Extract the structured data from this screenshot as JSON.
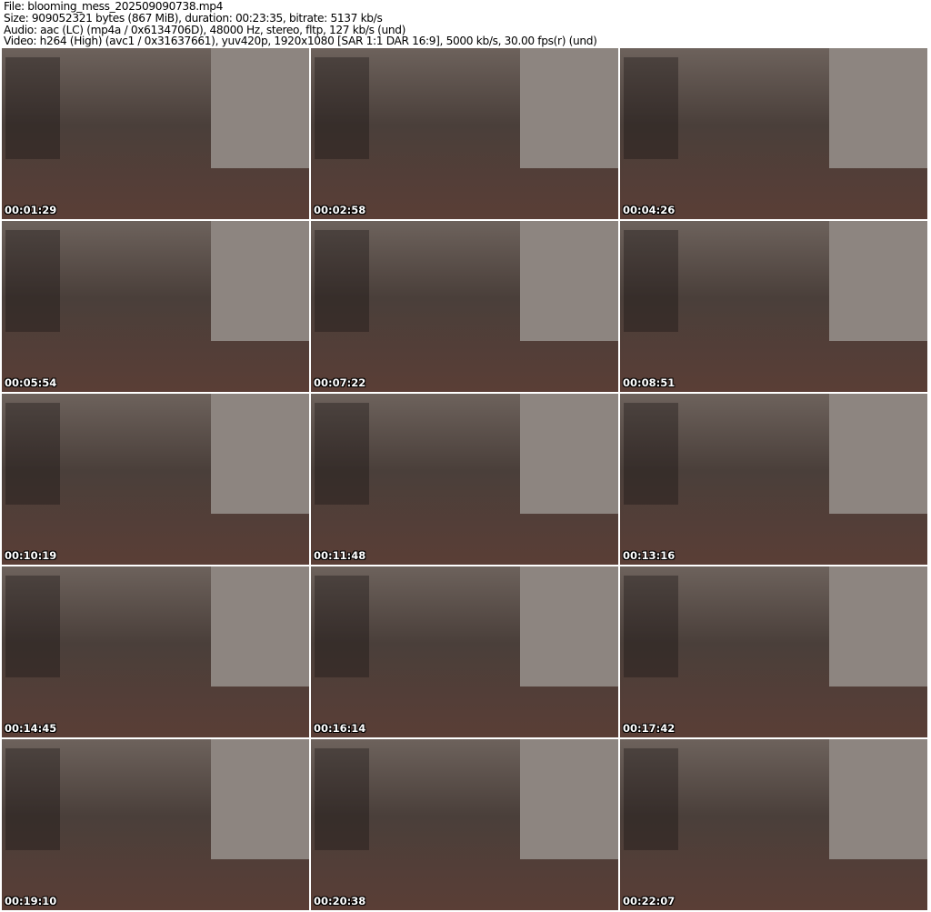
{
  "header": {
    "file": "File: blooming_mess_202509090738.mp4",
    "size": "Size: 909052321 bytes (867 MiB), duration: 00:23:35, bitrate: 5137 kb/s",
    "audio": "Audio: aac (LC) (mp4a / 0x6134706D), 48000 Hz, stereo, fltp, 127 kb/s (und)",
    "video": "Video: h264 (High) (avc1 / 0x31637661), yuv420p, 1920x1080 [SAR 1:1 DAR 16:9], 5000 kb/s, 30.00 fps(r) (und)"
  },
  "thumbnails": [
    "00:01:29",
    "00:02:58",
    "00:04:26",
    "00:05:54",
    "00:07:22",
    "00:08:51",
    "00:10:19",
    "00:11:48",
    "00:13:16",
    "00:14:45",
    "00:16:14",
    "00:17:42",
    "00:19:10",
    "00:20:38",
    "00:22:07"
  ]
}
